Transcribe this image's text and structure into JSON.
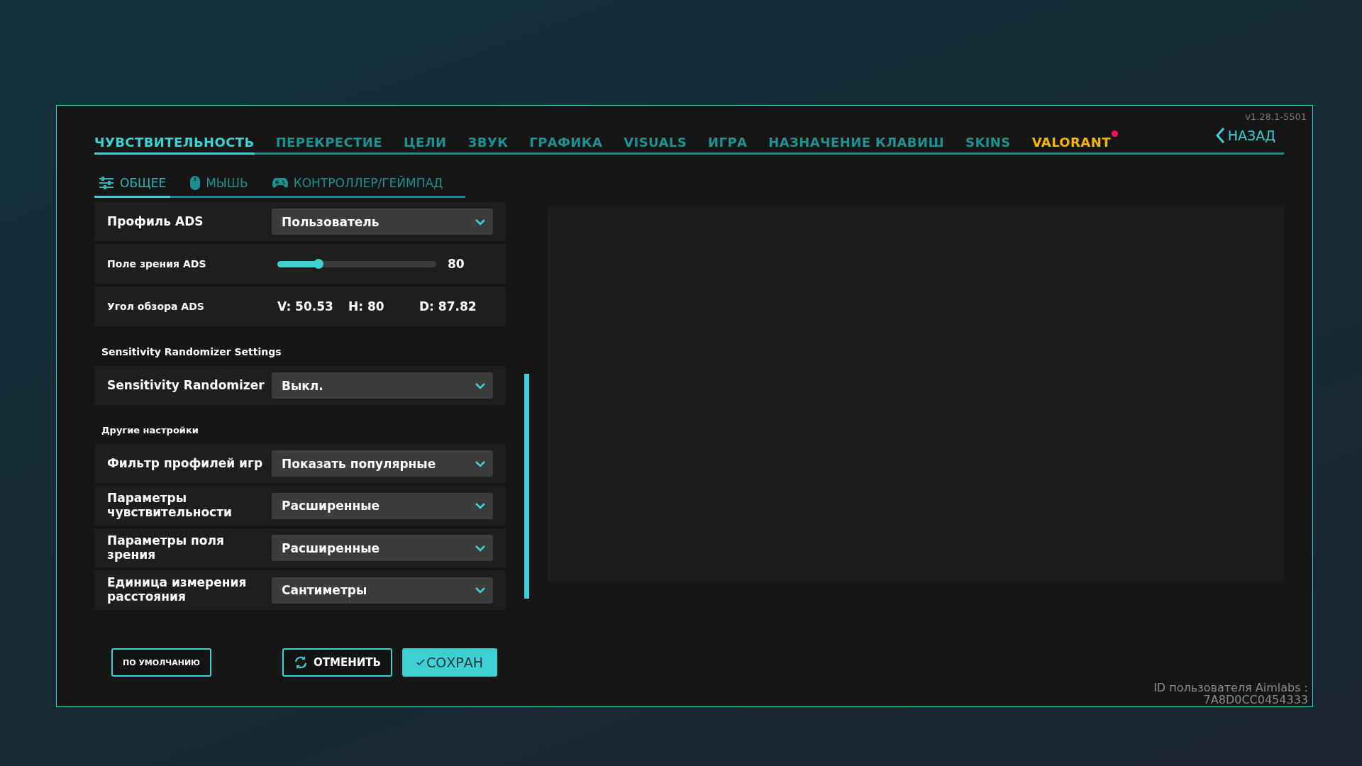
{
  "version": "v1.28.1-5501",
  "tabs": [
    {
      "label": "ЧУВСТВИТЕЛЬНОСТЬ",
      "selected": true,
      "kind": "normal"
    },
    {
      "label": "ПЕРЕКРЕСТИЕ",
      "selected": false,
      "kind": "normal"
    },
    {
      "label": "ЦЕЛИ",
      "selected": false,
      "kind": "normal"
    },
    {
      "label": "ЗВУК",
      "selected": false,
      "kind": "normal"
    },
    {
      "label": "ГРАФИКА",
      "selected": false,
      "kind": "normal"
    },
    {
      "label": "VISUALS",
      "selected": false,
      "kind": "normal"
    },
    {
      "label": "ИГРА",
      "selected": false,
      "kind": "normal"
    },
    {
      "label": "НАЗНАЧЕНИЕ КЛАВИШ",
      "selected": false,
      "kind": "normal"
    },
    {
      "label": "SKINS",
      "selected": false,
      "kind": "normal"
    },
    {
      "label": "VALORANT",
      "selected": false,
      "kind": "highlight",
      "notification": true
    }
  ],
  "back_button": "НАЗАД",
  "subtabs": [
    {
      "label": "ОБЩЕЕ",
      "selected": true
    },
    {
      "label": "МЫШЬ",
      "selected": false
    },
    {
      "label": "КОНТРОЛЛЕР/ГЕЙМПАД",
      "selected": false
    }
  ],
  "sections": [
    {
      "rows": [
        {
          "kind": "dropdown",
          "label": "Профиль ADS",
          "value": "Пользователь"
        },
        {
          "kind": "slider",
          "label": "Поле зрения ADS",
          "level": 0.26,
          "reading": "80"
        },
        {
          "kind": "readout",
          "label": "Угол обзора ADS",
          "values": [
            "V: 50.53",
            "H: 80",
            "D: 87.82"
          ]
        }
      ]
    },
    {
      "title": "Sensitivity Randomizer Settings",
      "rows": [
        {
          "kind": "dropdown",
          "label": "Sensitivity Randomizer",
          "value": "Выкл."
        }
      ]
    },
    {
      "title": "Другие настройки",
      "rows": [
        {
          "kind": "dropdown",
          "label": "Фильтр профилей игр",
          "value": "Показать популярные"
        },
        {
          "kind": "dropdown",
          "label": "Параметры чувствительности",
          "value": "Расширенные"
        },
        {
          "kind": "dropdown",
          "label": "Параметры поля зрения",
          "value": "Расширенные"
        },
        {
          "kind": "dropdown",
          "label": "Единица измерения расстояния",
          "value": "Сантиметры"
        }
      ]
    }
  ],
  "buttons": {
    "default": "ПО УМОЛЧАНИЮ",
    "cancel": "ОТМЕНИТЬ",
    "save": "СОХРАН"
  },
  "user_id": {
    "label": "ID пользователя Aimlabs :",
    "value": "7A8D0CC0454333"
  }
}
